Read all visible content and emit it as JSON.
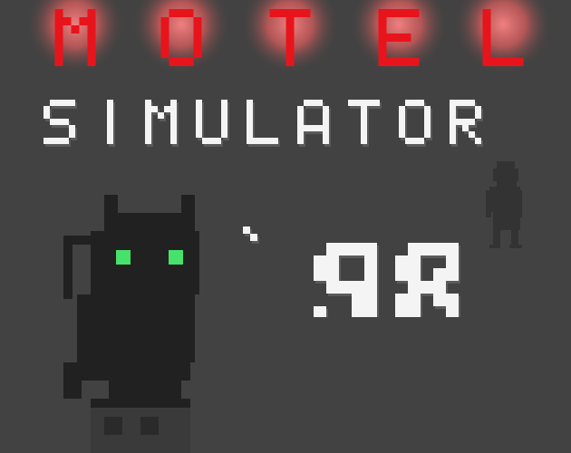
{
  "title_top": "MOTEL",
  "title_bottom": "SIMULATOR",
  "year": "'98",
  "colors": {
    "background": "#424242",
    "neon_red": "#e8141c",
    "neon_glow": "#e26a6a",
    "text_white": "#f4f4f4",
    "text_shadow": "#5a5a5a",
    "cat_body": "#212121",
    "cat_eyes": "#47e26b",
    "ghost_figure": "#333333"
  },
  "icons": [
    "neon-motel-sign",
    "black-cat-sprite",
    "shadow-figure-sprite"
  ]
}
